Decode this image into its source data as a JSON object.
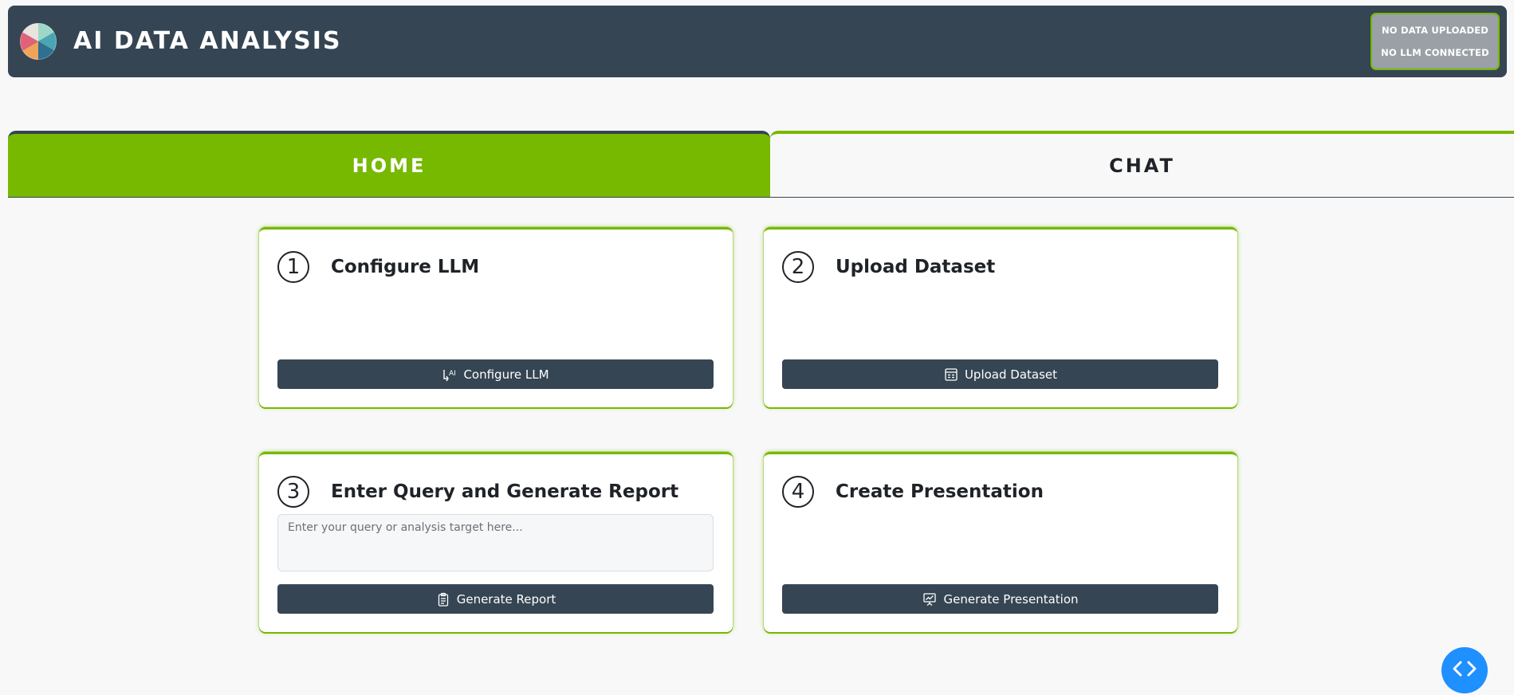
{
  "header": {
    "title": "AI DATA ANALYSIS",
    "logo_icon": "pie-chart-logo-icon",
    "status": {
      "data": "NO DATA UPLOADED",
      "llm": "NO LLM CONNECTED"
    }
  },
  "tabs": [
    {
      "label": "HOME",
      "active": true
    },
    {
      "label": "CHAT",
      "active": false
    }
  ],
  "cards": [
    {
      "step": "1",
      "title": "Configure LLM",
      "button_label": "Configure LLM",
      "button_icon": "ai-settings-icon"
    },
    {
      "step": "2",
      "title": "Upload Dataset",
      "button_label": "Upload Dataset",
      "button_icon": "dataset-icon"
    },
    {
      "step": "3",
      "title": "Enter Query and Generate Report",
      "input_placeholder": "Enter your query or analysis target here...",
      "input_value": "",
      "button_label": "Generate Report",
      "button_icon": "clipboard-icon"
    },
    {
      "step": "4",
      "title": "Create Presentation",
      "button_label": "Generate Presentation",
      "button_icon": "presentation-icon"
    }
  ],
  "fab": {
    "icon": "code-icon"
  },
  "colors": {
    "header_bg": "#354553",
    "accent": "#76b900",
    "button_bg": "#354553",
    "fab_bg": "#1e90ff",
    "page_bg": "#f8f8f8"
  }
}
